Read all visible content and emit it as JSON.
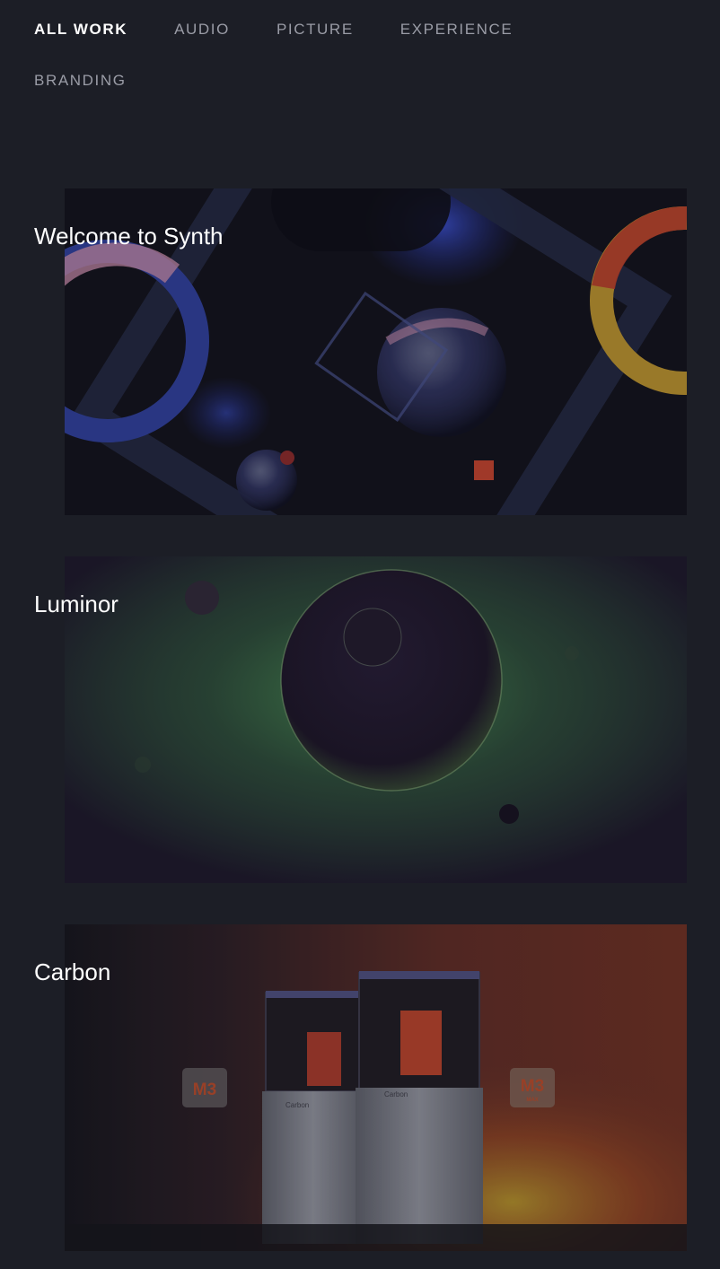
{
  "nav": {
    "items": [
      {
        "label": "ALL WORK",
        "active": true
      },
      {
        "label": "AUDIO",
        "active": false
      },
      {
        "label": "PICTURE",
        "active": false
      },
      {
        "label": "EXPERIENCE",
        "active": false
      },
      {
        "label": "BRANDING",
        "active": false
      }
    ]
  },
  "projects": [
    {
      "title": "Welcome to Synth"
    },
    {
      "title": "Luminor"
    },
    {
      "title": "Carbon",
      "badges": [
        "M3",
        "M3",
        "MAX"
      ],
      "printer_brand": "Carbon"
    }
  ],
  "colors": {
    "background": "#1c1e26",
    "nav_inactive": "#9a9ca6",
    "nav_active": "#ffffff"
  }
}
